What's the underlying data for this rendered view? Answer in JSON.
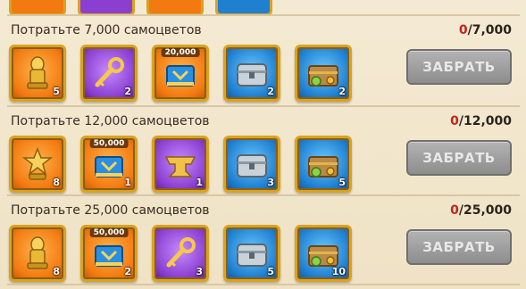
{
  "rows": [
    {
      "task": "Потратьте 7,000 самоцветов",
      "progress_current": "0",
      "progress_total": "/7,000",
      "claim_label": "ЗАБРАТЬ",
      "rewards": [
        {
          "icon": "golden-statue-icon",
          "bg": "orange",
          "count": "5",
          "value": ""
        },
        {
          "icon": "golden-key-icon",
          "bg": "purple",
          "count": "2",
          "value": ""
        },
        {
          "icon": "resource-book-icon",
          "bg": "orange",
          "count": "",
          "value": "20,000"
        },
        {
          "icon": "silver-chest-icon",
          "bg": "blue",
          "count": "2",
          "value": ""
        },
        {
          "icon": "resource-chest-icon",
          "bg": "blue",
          "count": "2",
          "value": ""
        }
      ]
    },
    {
      "task": "Потратьте 12,000 самоцветов",
      "progress_current": "0",
      "progress_total": "/12,000",
      "claim_label": "ЗАБРАТЬ",
      "rewards": [
        {
          "icon": "golden-star-statue-icon",
          "bg": "orange",
          "count": "8",
          "value": ""
        },
        {
          "icon": "resource-book-icon",
          "bg": "orange",
          "count": "1",
          "value": "50,000"
        },
        {
          "icon": "golden-anvil-icon",
          "bg": "purple",
          "count": "1",
          "value": ""
        },
        {
          "icon": "silver-chest-icon",
          "bg": "blue",
          "count": "3",
          "value": ""
        },
        {
          "icon": "resource-chest-icon",
          "bg": "blue",
          "count": "5",
          "value": ""
        }
      ]
    },
    {
      "task": "Потратьте 25,000 самоцветов",
      "progress_current": "0",
      "progress_total": "/25,000",
      "claim_label": "ЗАБРАТЬ",
      "rewards": [
        {
          "icon": "golden-statue-icon",
          "bg": "orange",
          "count": "8",
          "value": ""
        },
        {
          "icon": "resource-book-icon",
          "bg": "orange",
          "count": "2",
          "value": "50,000"
        },
        {
          "icon": "golden-key-icon",
          "bg": "purple",
          "count": "3",
          "value": ""
        },
        {
          "icon": "silver-chest-icon",
          "bg": "blue",
          "count": "5",
          "value": ""
        },
        {
          "icon": "resource-chest-icon",
          "bg": "blue",
          "count": "10",
          "value": ""
        }
      ]
    }
  ]
}
